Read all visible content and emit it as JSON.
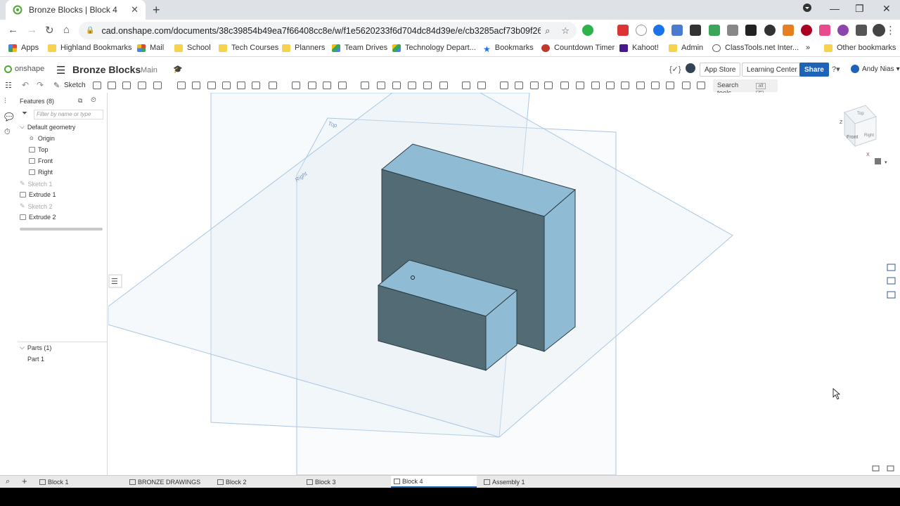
{
  "browser": {
    "tab_title": "Bronze Blocks | Block 4",
    "url": "cad.onshape.com/documents/38c39854b49ea7f66408cc8e/w/f1e5620233f6d704dc84d39e/e/cb3285acf73b09f26793...",
    "bookmarks": [
      {
        "label": "Apps"
      },
      {
        "label": "Highland Bookmarks"
      },
      {
        "label": "Mail"
      },
      {
        "label": "School"
      },
      {
        "label": "Tech Courses"
      },
      {
        "label": "Planners"
      },
      {
        "label": "Team Drives"
      },
      {
        "label": "Technology Depart..."
      },
      {
        "label": "Bookmarks"
      },
      {
        "label": "Countdown Timer"
      },
      {
        "label": "Kahoot!"
      },
      {
        "label": "Admin"
      },
      {
        "label": "ClassTools.net Inter..."
      }
    ],
    "bookmarks_more": "»",
    "other_bookmarks": "Other bookmarks"
  },
  "onshape": {
    "logo": "onshape",
    "doc_title": "Bronze Blocks",
    "branch": "Main",
    "app_store": "App Store",
    "learning_center": "Learning Center",
    "share": "Share",
    "user": "Andy Nias"
  },
  "toolbar": {
    "sketch": "Sketch",
    "search_tools": "Search tools...",
    "shortcut_alt": "alt",
    "shortcut_c": "C"
  },
  "features": {
    "header": "Features (8)",
    "filter_placeholder": "Filter by name or type",
    "default_geometry": "Default geometry",
    "items": [
      {
        "label": "Origin"
      },
      {
        "label": "Top"
      },
      {
        "label": "Front"
      },
      {
        "label": "Right"
      },
      {
        "label": "Sketch 1"
      },
      {
        "label": "Extrude 1"
      },
      {
        "label": "Sketch 2"
      },
      {
        "label": "Extrude 2"
      }
    ],
    "parts_header": "Parts (1)",
    "parts": [
      {
        "label": "Part 1"
      }
    ]
  },
  "viewport": {
    "plane_top": "Top",
    "plane_right": "Right",
    "cube_front": "Front",
    "cube_top": "Top",
    "cube_right": "Right",
    "axis_z": "Z",
    "axis_x": "X"
  },
  "bottom_tabs": [
    {
      "label": "Block 1"
    },
    {
      "label": "BRONZE DRAWINGS"
    },
    {
      "label": "Block 2"
    },
    {
      "label": "Block 3"
    },
    {
      "label": "Block 4"
    },
    {
      "label": "Assembly 1"
    }
  ],
  "colors": {
    "face_light": "#8fbcd4",
    "face_dark": "#536b75",
    "plane_line": "#a9c6e4",
    "accent": "#1f63b8"
  }
}
